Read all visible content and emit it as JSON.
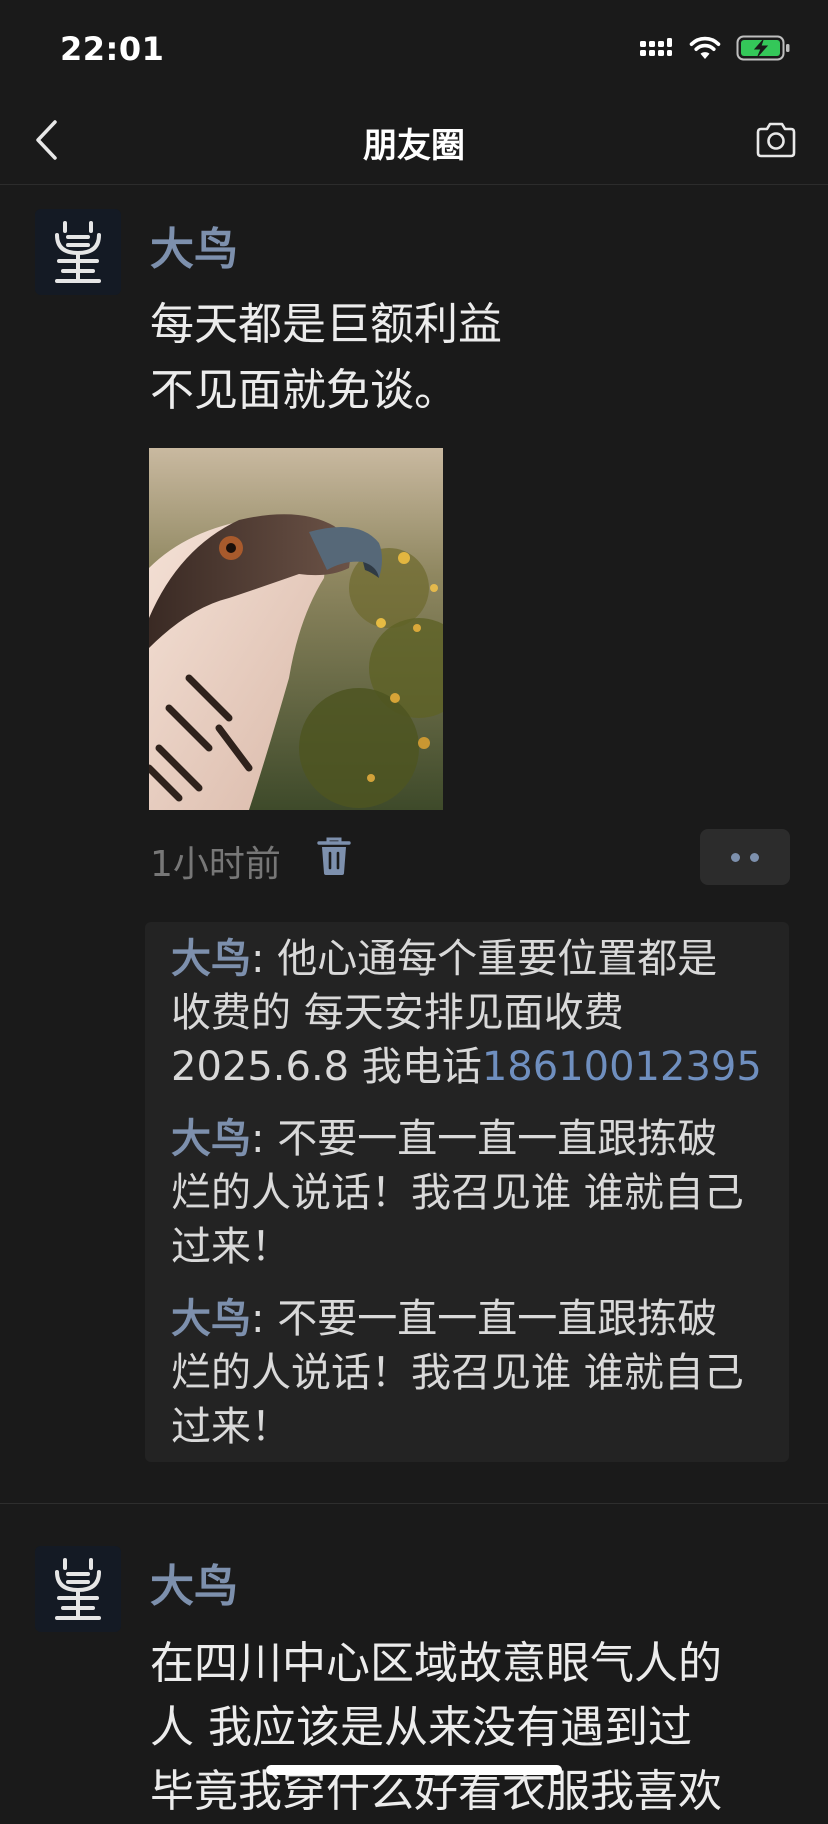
{
  "status_bar": {
    "time": "22:01"
  },
  "nav": {
    "title": "朋友圈",
    "back_icon": "chevron-left-icon",
    "camera_icon": "camera-icon"
  },
  "posts": [
    {
      "author": "大鸟",
      "text_lines": [
        "每天都是巨额利益",
        "不见面就免谈。"
      ],
      "time": "1小时前",
      "comments": [
        {
          "author": "大鸟",
          "separator": ": ",
          "lines": [
            "他心通每个重要位置都是",
            "收费的 每天安排见面收费",
            "2025.6.8 我电话"
          ],
          "phone": "18610012395"
        },
        {
          "author": "大鸟",
          "separator": ": ",
          "lines": [
            "不要一直一直一直跟拣破",
            "烂的人说话！我召见谁 谁就自己",
            "过来！"
          ]
        },
        {
          "author": "大鸟",
          "separator": ": ",
          "lines": [
            "不要一直一直一直跟拣破",
            "烂的人说话！我召见谁 谁就自己",
            "过来！"
          ]
        }
      ]
    },
    {
      "author": "大鸟",
      "text_lines": [
        "在四川中心区域故意眼气人的",
        "人 我应该是从来没有遇到过",
        "毕竟我穿什么好看衣服我喜欢"
      ]
    }
  ],
  "colors": {
    "background": "#1a1a1a",
    "name_link": "#7d90ad",
    "phone_link": "#6f8fbf",
    "comment_bg": "#232323"
  }
}
